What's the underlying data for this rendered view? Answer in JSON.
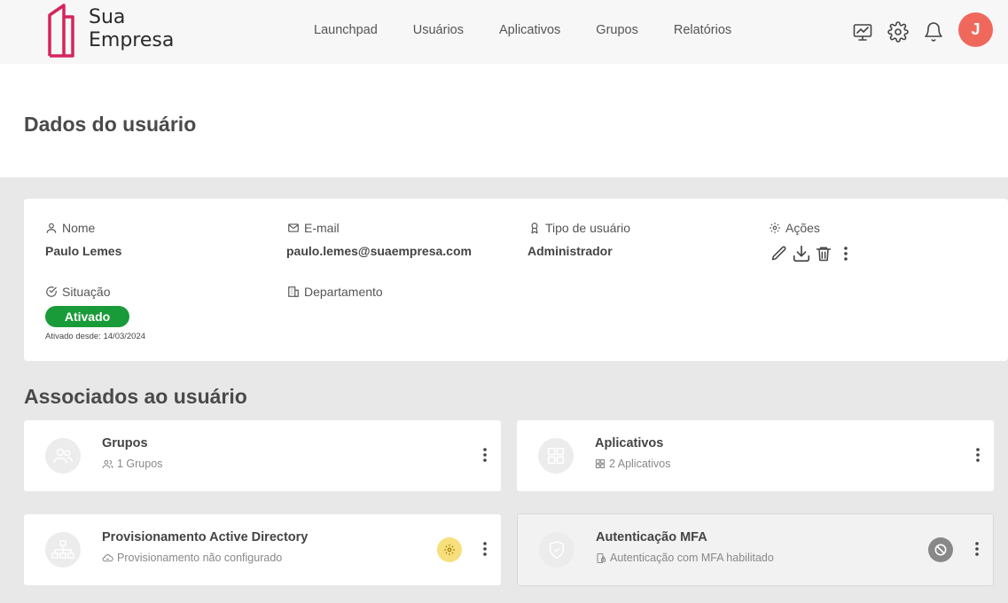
{
  "brand": {
    "line1": "Sua",
    "line2": "Empresa",
    "accent": "#d6245c"
  },
  "nav": [
    {
      "label": "Launchpad"
    },
    {
      "label": "Usuários"
    },
    {
      "label": "Aplicativos"
    },
    {
      "label": "Grupos"
    },
    {
      "label": "Relatórios"
    }
  ],
  "header_icons": [
    "monitor-chart-icon",
    "gear-icon",
    "bell-icon"
  ],
  "avatar": {
    "initial": "J",
    "color": "#f0685c"
  },
  "page": {
    "title": "Dados do usuário"
  },
  "user": {
    "name_label": "Nome",
    "name": "Paulo Lemes",
    "email_label": "E-mail",
    "email": "paulo.lemes@suaempresa.com",
    "type_label": "Tipo de usuário",
    "type": "Administrador",
    "actions_label": "Ações",
    "status_label": "Situação",
    "status": "Ativado",
    "status_color": "#1a9b3a",
    "status_since": "Ativado desde: 14/03/2024",
    "department_label": "Departamento"
  },
  "associated": {
    "title": "Associados ao usuário",
    "cards": [
      {
        "title": "Grupos",
        "subtitle": "1 Grupos"
      },
      {
        "title": "Aplicativos",
        "subtitle": "2 Aplicativos"
      },
      {
        "title": "Provisionamento Active Directory",
        "subtitle": "Provisionamento não configurado"
      },
      {
        "title": "Autenticação MFA",
        "subtitle": "Autenticação com MFA habilitado"
      }
    ]
  }
}
